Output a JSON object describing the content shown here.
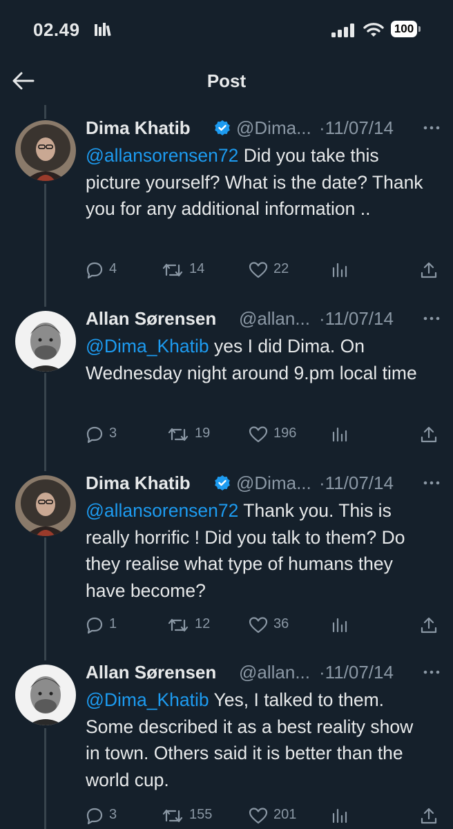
{
  "status_bar": {
    "time": "02.49",
    "battery": "100"
  },
  "header": {
    "title": "Post"
  },
  "tweets": [
    {
      "author": "Dima Khatib",
      "handle": "@Dima...",
      "date": "·11/07/14",
      "mention": "@allansorensen72",
      "text": " Did you take this picture yourself? What is the date? Thank you for any additional information ..",
      "replies": "4",
      "retweets": "14",
      "likes": "22"
    },
    {
      "author": "Allan Sørensen",
      "handle": "@allan...",
      "date": "·11/07/14",
      "mention": "@Dima_Khatib",
      "text": " yes I did Dima. On Wednesday night around 9.pm local time",
      "replies": "3",
      "retweets": "19",
      "likes": "196"
    },
    {
      "author": "Dima Khatib",
      "handle": "@Dima...",
      "date": "·11/07/14",
      "mention": "@allansorensen72",
      "text": " Thank you. This is really horrific ! Did you talk to them? Do they realise what type of humans they have become?",
      "replies": "1",
      "retweets": "12",
      "likes": "36"
    },
    {
      "author": "Allan Sørensen",
      "handle": "@allan...",
      "date": "·11/07/14",
      "mention": "@Dima_Khatib",
      "text": " Yes, I talked to them. Some described it as a best reality show in town. Others said it is better than the world cup.",
      "replies": "3",
      "retweets": "155",
      "likes": "201"
    }
  ],
  "colors": {
    "background": "#15202b",
    "link": "#1d9bf0",
    "secondary": "#8b98a5",
    "verified": "#1d9bf0"
  },
  "icons": [
    "back-arrow-icon",
    "verified-icon",
    "more-icon",
    "reply-icon",
    "retweet-icon",
    "like-icon",
    "views-icon",
    "share-icon"
  ]
}
